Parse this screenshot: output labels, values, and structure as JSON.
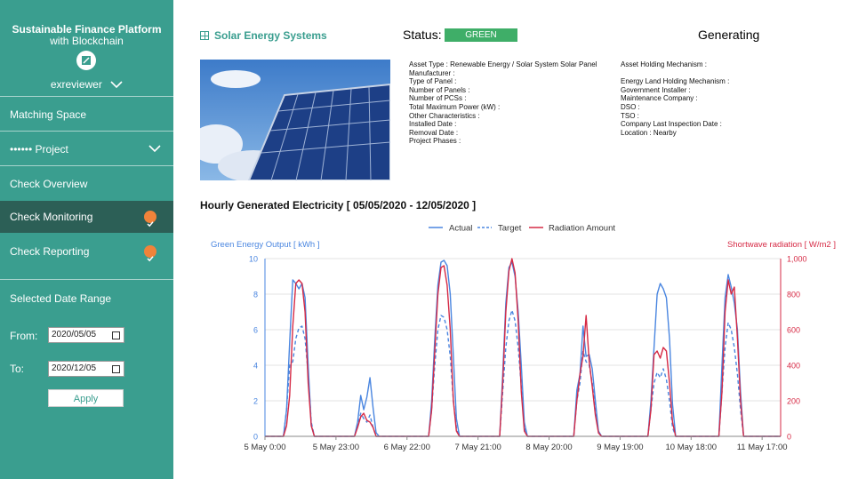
{
  "sidebar": {
    "app_title_line1": "Sustainable Finance Platform",
    "app_title_line2": "with Blockchain",
    "username": "exreviewer",
    "items": [
      {
        "label": "Matching Space"
      },
      {
        "label": "•••••• Project"
      },
      {
        "label": "Check Overview"
      },
      {
        "label": "Check Monitoring",
        "checked": true
      },
      {
        "label": "Check Reporting",
        "checked": true
      }
    ],
    "date_range_title": "Selected Date Range",
    "from_label": "From:",
    "from_value": "2020/05/05",
    "to_label": "To:",
    "to_value": "2020/12/05",
    "apply_label": "Apply"
  },
  "header": {
    "title": "Solar Energy Systems",
    "status_label": "Status:",
    "status_value": "GREEN",
    "state": "Generating"
  },
  "asset_details_left": [
    "Asset Type : Renewable Energy / Solar System Solar Panel",
    "Manufacturer :",
    "Type of Panel :",
    "Number of Panels :",
    "Number of PCSs :",
    "Total Maximum Power (kW) :",
    "Other Characteristics :",
    "Installed Date :",
    "Removal Date :",
    "Project Phases :"
  ],
  "asset_details_right": [
    "Asset Holding Mechanism :",
    "",
    "Energy Land Holding Mechanism :",
    "Government Installer :",
    "Maintenance Company :",
    "DSO :",
    "TSO :",
    "Company Last Inspection Date :",
    "Location : Nearby"
  ],
  "colors": {
    "sidebar_bg": "#3a9e8f",
    "sidebar_active": "#2c5f56",
    "accent": "#3a9e8f",
    "status_green": "#3fae68",
    "check_orange": "#f0833a",
    "actual": "#4a86e0",
    "radiation": "#d62a45"
  },
  "icons": [
    "chevron-down-icon",
    "app-logo-icon",
    "grid-icon",
    "checkmark-icon",
    "calendar-icon"
  ],
  "chart_data": {
    "type": "line",
    "title": "Hourly Generated Electricity [ 05/05/2020 - 12/05/2020 ]",
    "ylabel_left": "Green Energy Output [ kWh ]",
    "ylabel_right": "Shortwave radiation [ W/m2 ]",
    "ylim_left": [
      0,
      10
    ],
    "ylim_right": [
      0,
      1000
    ],
    "yticks_left": [
      "0",
      "2",
      "4",
      "6",
      "8",
      "10"
    ],
    "yticks_right": [
      "0",
      "200",
      "400",
      "600",
      "800",
      "1,000"
    ],
    "x_ticks": [
      "5 May 0:00",
      "5 May 23:00",
      "6 May 22:00",
      "7 May 21:00",
      "8 May 20:00",
      "9 May 19:00",
      "10 May 18:00",
      "11 May 17:00"
    ],
    "x_tick_hours": [
      0,
      23,
      46,
      69,
      92,
      115,
      138,
      161
    ],
    "x_max_hours": 167,
    "legend": [
      "Actual",
      "Target",
      "Radiation Amount"
    ],
    "legend_position": "top-center",
    "grid": true,
    "series": [
      {
        "name": "Actual",
        "axis": "left",
        "style": "solid",
        "points": [
          [
            0,
            0
          ],
          [
            6,
            0
          ],
          [
            7,
            1.5
          ],
          [
            8,
            5.3
          ],
          [
            9,
            8.8
          ],
          [
            10,
            8.6
          ],
          [
            11,
            8.3
          ],
          [
            12,
            8.6
          ],
          [
            13,
            7.8
          ],
          [
            14,
            4
          ],
          [
            15,
            0.6
          ],
          [
            16,
            0
          ],
          [
            29,
            0
          ],
          [
            30,
            0.8
          ],
          [
            31,
            2.3
          ],
          [
            32,
            1.5
          ],
          [
            33,
            2.2
          ],
          [
            34,
            3.3
          ],
          [
            35,
            1.6
          ],
          [
            36,
            0.2
          ],
          [
            37,
            0
          ],
          [
            53,
            0
          ],
          [
            54,
            2
          ],
          [
            55,
            5.5
          ],
          [
            56,
            8.5
          ],
          [
            57,
            9.8
          ],
          [
            58,
            9.9
          ],
          [
            59,
            9.6
          ],
          [
            60,
            8
          ],
          [
            61,
            4.5
          ],
          [
            62,
            1
          ],
          [
            63,
            0
          ],
          [
            76,
            0
          ],
          [
            77,
            3.5
          ],
          [
            78,
            7.5
          ],
          [
            79,
            9.5
          ],
          [
            80,
            9.8
          ],
          [
            81,
            9
          ],
          [
            82,
            7
          ],
          [
            83,
            4
          ],
          [
            84,
            0.8
          ],
          [
            85,
            0
          ],
          [
            100,
            0
          ],
          [
            101,
            2.6
          ],
          [
            102,
            3.5
          ],
          [
            103,
            6.2
          ],
          [
            104,
            4.5
          ],
          [
            105,
            4.6
          ],
          [
            106,
            3.8
          ],
          [
            107,
            2
          ],
          [
            108,
            0.3
          ],
          [
            109,
            0
          ],
          [
            124,
            0
          ],
          [
            125,
            2
          ],
          [
            126,
            5
          ],
          [
            127,
            8
          ],
          [
            128,
            8.6
          ],
          [
            129,
            8.3
          ],
          [
            130,
            7.8
          ],
          [
            131,
            5.5
          ],
          [
            132,
            1.8
          ],
          [
            133,
            0
          ],
          [
            147,
            0
          ],
          [
            148,
            4
          ],
          [
            149,
            7.8
          ],
          [
            150,
            9.1
          ],
          [
            151,
            8.4
          ],
          [
            152,
            7.5
          ],
          [
            153,
            6
          ],
          [
            154,
            2.5
          ],
          [
            155,
            0
          ],
          [
            167,
            0
          ]
        ]
      },
      {
        "name": "Target",
        "axis": "left",
        "style": "dashed",
        "points": [
          [
            0,
            0
          ],
          [
            6,
            0
          ],
          [
            7,
            1.5
          ],
          [
            8,
            4
          ],
          [
            9,
            4.2
          ],
          [
            10,
            5.5
          ],
          [
            11,
            6.1
          ],
          [
            12,
            6.2
          ],
          [
            13,
            5.5
          ],
          [
            14,
            3.5
          ],
          [
            15,
            0.8
          ],
          [
            16,
            0
          ],
          [
            29,
            0
          ],
          [
            30,
            0.6
          ],
          [
            31,
            1.3
          ],
          [
            32,
            1
          ],
          [
            33,
            0.8
          ],
          [
            34,
            1.2
          ],
          [
            35,
            0.5
          ],
          [
            36,
            0
          ],
          [
            53,
            0
          ],
          [
            54,
            1.5
          ],
          [
            55,
            4
          ],
          [
            56,
            6
          ],
          [
            57,
            6.8
          ],
          [
            58,
            6.7
          ],
          [
            59,
            6
          ],
          [
            60,
            4.5
          ],
          [
            61,
            2
          ],
          [
            62,
            0.5
          ],
          [
            63,
            0
          ],
          [
            76,
            0
          ],
          [
            77,
            2.5
          ],
          [
            78,
            5
          ],
          [
            79,
            6.5
          ],
          [
            80,
            7.1
          ],
          [
            81,
            6.5
          ],
          [
            82,
            5
          ],
          [
            83,
            2.8
          ],
          [
            84,
            0.5
          ],
          [
            85,
            0
          ],
          [
            100,
            0
          ],
          [
            101,
            2
          ],
          [
            102,
            3
          ],
          [
            103,
            4.8
          ],
          [
            104,
            4.2
          ],
          [
            105,
            4
          ],
          [
            106,
            3
          ],
          [
            107,
            1.5
          ],
          [
            108,
            0.2
          ],
          [
            109,
            0
          ],
          [
            124,
            0
          ],
          [
            125,
            1.5
          ],
          [
            126,
            3
          ],
          [
            127,
            3.6
          ],
          [
            128,
            3.3
          ],
          [
            129,
            3.8
          ],
          [
            130,
            3.2
          ],
          [
            131,
            2
          ],
          [
            132,
            0.5
          ],
          [
            133,
            0
          ],
          [
            147,
            0
          ],
          [
            148,
            2.5
          ],
          [
            149,
            5
          ],
          [
            150,
            6.4
          ],
          [
            151,
            6
          ],
          [
            152,
            5
          ],
          [
            153,
            3.5
          ],
          [
            154,
            1.5
          ],
          [
            155,
            0
          ],
          [
            167,
            0
          ]
        ]
      },
      {
        "name": "Radiation Amount",
        "axis": "right",
        "style": "solid",
        "points": [
          [
            0,
            0
          ],
          [
            6,
            0
          ],
          [
            7,
            60
          ],
          [
            8,
            230
          ],
          [
            9,
            620
          ],
          [
            10,
            860
          ],
          [
            11,
            880
          ],
          [
            12,
            860
          ],
          [
            13,
            700
          ],
          [
            14,
            300
          ],
          [
            15,
            60
          ],
          [
            16,
            0
          ],
          [
            29,
            0
          ],
          [
            30,
            50
          ],
          [
            31,
            110
          ],
          [
            32,
            130
          ],
          [
            33,
            90
          ],
          [
            34,
            80
          ],
          [
            35,
            50
          ],
          [
            36,
            0
          ],
          [
            53,
            0
          ],
          [
            54,
            150
          ],
          [
            55,
            480
          ],
          [
            56,
            800
          ],
          [
            57,
            950
          ],
          [
            58,
            960
          ],
          [
            59,
            850
          ],
          [
            60,
            600
          ],
          [
            61,
            200
          ],
          [
            62,
            30
          ],
          [
            63,
            0
          ],
          [
            76,
            0
          ],
          [
            77,
            300
          ],
          [
            78,
            700
          ],
          [
            79,
            930
          ],
          [
            80,
            1000
          ],
          [
            81,
            920
          ],
          [
            82,
            650
          ],
          [
            83,
            250
          ],
          [
            84,
            30
          ],
          [
            85,
            0
          ],
          [
            100,
            0
          ],
          [
            101,
            200
          ],
          [
            102,
            350
          ],
          [
            103,
            450
          ],
          [
            104,
            680
          ],
          [
            105,
            420
          ],
          [
            106,
            280
          ],
          [
            107,
            120
          ],
          [
            108,
            20
          ],
          [
            109,
            0
          ],
          [
            124,
            0
          ],
          [
            125,
            150
          ],
          [
            126,
            460
          ],
          [
            127,
            480
          ],
          [
            128,
            440
          ],
          [
            129,
            500
          ],
          [
            130,
            480
          ],
          [
            131,
            300
          ],
          [
            132,
            80
          ],
          [
            133,
            0
          ],
          [
            147,
            0
          ],
          [
            148,
            250
          ],
          [
            149,
            700
          ],
          [
            150,
            880
          ],
          [
            151,
            800
          ],
          [
            152,
            840
          ],
          [
            153,
            550
          ],
          [
            154,
            200
          ],
          [
            155,
            0
          ],
          [
            167,
            0
          ]
        ]
      }
    ]
  }
}
